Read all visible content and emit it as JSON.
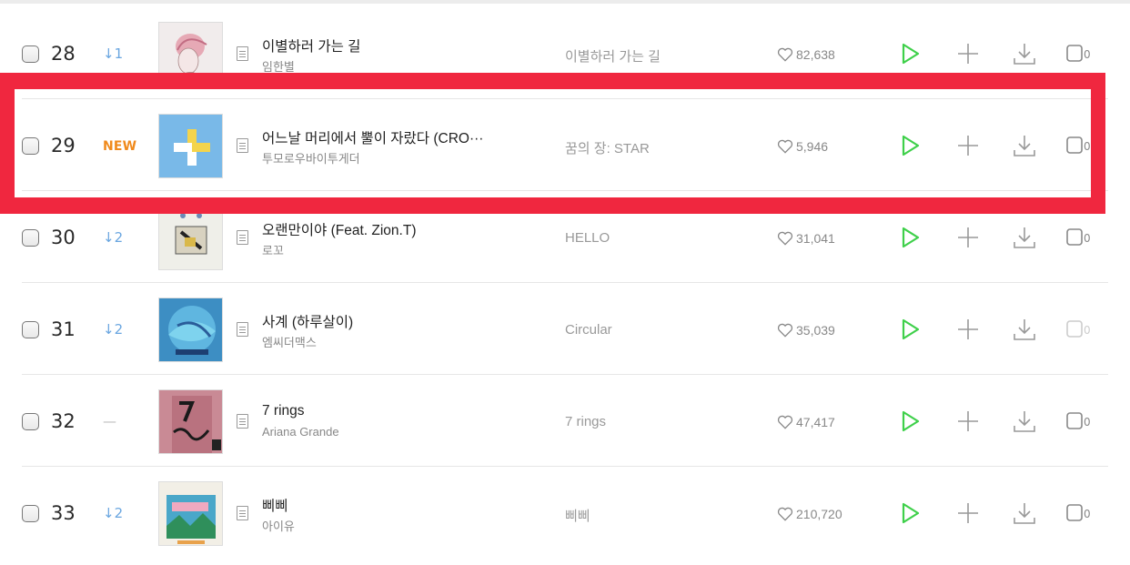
{
  "rows": [
    {
      "rank": "28",
      "change": "↓1",
      "change_type": "down",
      "title": "이별하러 가는 길",
      "artist": "임한별",
      "album": "이별하러 가는 길",
      "likes": "82,638",
      "cover": "sketch-portrait"
    },
    {
      "rank": "29",
      "change": "NEW",
      "change_type": "new",
      "title": "어느날 머리에서 뿔이 자랐다 (CRO···",
      "artist": "투모로우바이투게더",
      "album": "꿈의 장: STAR",
      "likes": "5,946",
      "cover": "blue-plus"
    },
    {
      "rank": "30",
      "change": "↓2",
      "change_type": "down",
      "title": "오랜만이야 (Feat. Zion.T)",
      "artist": "로꼬",
      "album": "HELLO",
      "likes": "31,041",
      "cover": "hello-art"
    },
    {
      "rank": "31",
      "change": "↓2",
      "change_type": "down",
      "title": "사계 (하루살이)",
      "artist": "엠씨더맥스",
      "album": "Circular",
      "likes": "35,039",
      "cover": "circular-blue"
    },
    {
      "rank": "32",
      "change": "—",
      "change_type": "same",
      "title": "7 rings",
      "artist": "Ariana Grande",
      "album": "7 rings",
      "likes": "47,417",
      "cover": "pink-door"
    },
    {
      "rank": "33",
      "change": "↓2",
      "change_type": "down",
      "title": "삐삐",
      "artist": "아이유",
      "album": "삐삐",
      "likes": "210,720",
      "cover": "bbibbi-art"
    }
  ],
  "mv_label": "0",
  "colors": {
    "accent_green": "#3ed04a",
    "highlight_red": "#f0273f",
    "new_orange": "#f08a1c",
    "down_blue": "#6aa6e0"
  }
}
